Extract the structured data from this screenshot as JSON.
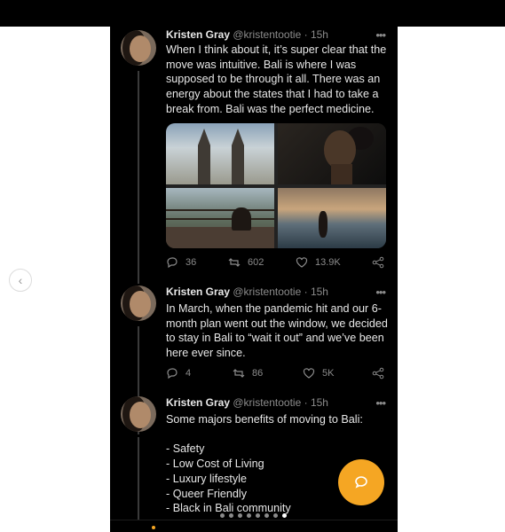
{
  "nav": {
    "prev_icon": "chevron-left-icon"
  },
  "tweets": [
    {
      "name": "Kristen Gray",
      "handle": "@kristentootie",
      "time": "15h",
      "body": "When I think about it, it’s super  clear that the move was intuitive. Bali is where I was supposed to be through it all. There was an energy about the states that I had to take a break from. Bali was the perfect medicine.",
      "actions": {
        "replies": "36",
        "retweets": "602",
        "likes": "13.9K"
      }
    },
    {
      "name": "Kristen Gray",
      "handle": "@kristentootie",
      "time": "15h",
      "body": "In March, when the pandemic hit and our 6-month plan went out the window, we decided to stay in Bali to “wait it out” and we’ve been here ever since.",
      "actions": {
        "replies": "4",
        "retweets": "86",
        "likes": "5K"
      }
    },
    {
      "name": "Kristen Gray",
      "handle": "@kristentootie",
      "time": "15h",
      "body_intro": "Some majors benefits of moving to Bali:",
      "list": [
        "- Safety",
        "- Low Cost of Living",
        "- Luxury lifestyle",
        "- Queer Friendly",
        "- Black in Bali community"
      ]
    }
  ],
  "separator": "·",
  "more_glyph": "•••",
  "carousel": {
    "count": 8,
    "active_index": 7
  },
  "fab": {
    "icon": "chat-bubble-icon",
    "color": "#f5a623"
  },
  "colors": {
    "background": "#000000",
    "text": "#e7e7e7",
    "muted": "#8b8b8b",
    "accent": "#f5a623"
  }
}
